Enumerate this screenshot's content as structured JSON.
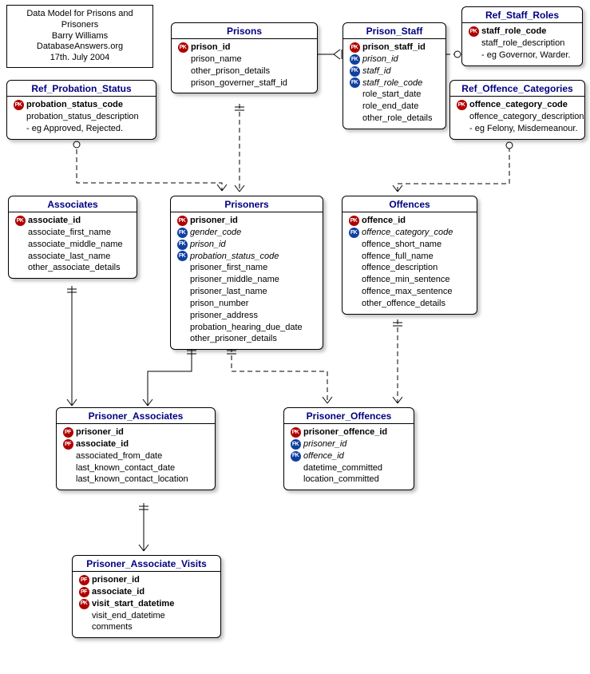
{
  "info": {
    "title": "Data Model for Prisons and Prisoners",
    "author": "Barry Williams",
    "source": "DatabaseAnswers.org",
    "date": "17th. July 2004"
  },
  "key_legend": {
    "PK": "Primary Key",
    "FK": "Foreign Key",
    "PF": "Primary/Foreign Key"
  },
  "entities": {
    "prisons": {
      "name": "Prisons",
      "attributes": [
        {
          "key": "PK",
          "name": "prison_id",
          "bold": true
        },
        {
          "key": null,
          "name": "prison_name"
        },
        {
          "key": null,
          "name": "other_prison_details"
        },
        {
          "key": null,
          "name": "prison_governer_staff_id"
        }
      ]
    },
    "prison_staff": {
      "name": "Prison_Staff",
      "attributes": [
        {
          "key": "PK",
          "name": "prison_staff_id",
          "bold": true
        },
        {
          "key": "FK",
          "name": "prison_id",
          "italic": true
        },
        {
          "key": "FK",
          "name": "staff_id",
          "italic": true
        },
        {
          "key": "FK",
          "name": "staff_role_code",
          "italic": true
        },
        {
          "key": null,
          "name": "role_start_date"
        },
        {
          "key": null,
          "name": "role_end_date"
        },
        {
          "key": null,
          "name": "other_role_details"
        }
      ]
    },
    "ref_staff_roles": {
      "name": "Ref_Staff_Roles",
      "attributes": [
        {
          "key": "PK",
          "name": "staff_role_code",
          "bold": true
        },
        {
          "key": null,
          "name": "staff_role_description"
        },
        {
          "key": null,
          "name": "- eg Governor, Warder."
        }
      ]
    },
    "ref_probation_status": {
      "name": "Ref_Probation_Status",
      "attributes": [
        {
          "key": "PK",
          "name": "probation_status_code",
          "bold": true
        },
        {
          "key": null,
          "name": "probation_status_description"
        },
        {
          "key": null,
          "name": "- eg Approved, Rejected."
        }
      ]
    },
    "ref_offence_categories": {
      "name": "Ref_Offence_Categories",
      "attributes": [
        {
          "key": "PK",
          "name": "offence_category_code",
          "bold": true
        },
        {
          "key": null,
          "name": "offence_category_description"
        },
        {
          "key": null,
          "name": "- eg Felony, Misdemeanour."
        }
      ]
    },
    "associates": {
      "name": "Associates",
      "attributes": [
        {
          "key": "PK",
          "name": "associate_id",
          "bold": true
        },
        {
          "key": null,
          "name": "associate_first_name"
        },
        {
          "key": null,
          "name": "associate_middle_name"
        },
        {
          "key": null,
          "name": "associate_last_name"
        },
        {
          "key": null,
          "name": "other_associate_details"
        }
      ]
    },
    "prisoners": {
      "name": "Prisoners",
      "attributes": [
        {
          "key": "PK",
          "name": "prisoner_id",
          "bold": true
        },
        {
          "key": "FK",
          "name": "gender_code",
          "italic": true
        },
        {
          "key": "FK",
          "name": "prison_id",
          "italic": true
        },
        {
          "key": "FK",
          "name": "probation_status_code",
          "italic": true
        },
        {
          "key": null,
          "name": "prisoner_first_name"
        },
        {
          "key": null,
          "name": "prisoner_middle_name"
        },
        {
          "key": null,
          "name": "prisoner_last_name"
        },
        {
          "key": null,
          "name": "prison_number"
        },
        {
          "key": null,
          "name": "prisoner_address"
        },
        {
          "key": null,
          "name": "probation_hearing_due_date"
        },
        {
          "key": null,
          "name": "other_prisoner_details"
        }
      ]
    },
    "offences": {
      "name": "Offences",
      "attributes": [
        {
          "key": "PK",
          "name": "offence_id",
          "bold": true
        },
        {
          "key": "FK",
          "name": "offence_category_code",
          "italic": true
        },
        {
          "key": null,
          "name": "offence_short_name"
        },
        {
          "key": null,
          "name": "offence_full_name"
        },
        {
          "key": null,
          "name": "offence_description"
        },
        {
          "key": null,
          "name": "offence_min_sentence"
        },
        {
          "key": null,
          "name": "offence_max_sentence"
        },
        {
          "key": null,
          "name": "other_offence_details"
        }
      ]
    },
    "prisoner_associates": {
      "name": "Prisoner_Associates",
      "attributes": [
        {
          "key": "PF",
          "name": "prisoner_id",
          "bold": true
        },
        {
          "key": "PF",
          "name": "associate_id",
          "bold": true
        },
        {
          "key": null,
          "name": "associated_from_date"
        },
        {
          "key": null,
          "name": "last_known_contact_date"
        },
        {
          "key": null,
          "name": "last_known_contact_location"
        }
      ]
    },
    "prisoner_offences": {
      "name": "Prisoner_Offences",
      "attributes": [
        {
          "key": "PK",
          "name": "prisoner_offence_id",
          "bold": true
        },
        {
          "key": "FK",
          "name": "prisoner_id",
          "italic": true
        },
        {
          "key": "FK",
          "name": "offence_id",
          "italic": true
        },
        {
          "key": null,
          "name": "datetime_committed"
        },
        {
          "key": null,
          "name": "location_committed"
        }
      ]
    },
    "prisoner_associate_visits": {
      "name": "Prisoner_Associate_Visits",
      "attributes": [
        {
          "key": "PF",
          "name": "prisoner_id",
          "bold": true
        },
        {
          "key": "PF",
          "name": "associate_id",
          "bold": true
        },
        {
          "key": "PK",
          "name": "visit_start_datetime",
          "bold": true
        },
        {
          "key": null,
          "name": "visit_end_datetime"
        },
        {
          "key": null,
          "name": "comments"
        }
      ]
    }
  },
  "relationships": [
    {
      "from": "prisons",
      "to": "prison_staff",
      "type": "one-to-many",
      "identifying": true
    },
    {
      "from": "ref_staff_roles",
      "to": "prison_staff",
      "type": "one-to-many",
      "identifying": false
    },
    {
      "from": "ref_probation_status",
      "to": "prisoners",
      "type": "one-to-many",
      "identifying": false
    },
    {
      "from": "prisons",
      "to": "prisoners",
      "type": "one-to-many",
      "identifying": false
    },
    {
      "from": "ref_offence_categories",
      "to": "offences",
      "type": "one-to-many",
      "identifying": false
    },
    {
      "from": "associates",
      "to": "prisoner_associates",
      "type": "one-to-many",
      "identifying": true
    },
    {
      "from": "prisoners",
      "to": "prisoner_associates",
      "type": "one-to-many",
      "identifying": true
    },
    {
      "from": "prisoners",
      "to": "prisoner_offences",
      "type": "one-to-many",
      "identifying": false
    },
    {
      "from": "offences",
      "to": "prisoner_offences",
      "type": "one-to-many",
      "identifying": false
    },
    {
      "from": "prisoner_associates",
      "to": "prisoner_associate_visits",
      "type": "one-to-many",
      "identifying": true
    }
  ]
}
